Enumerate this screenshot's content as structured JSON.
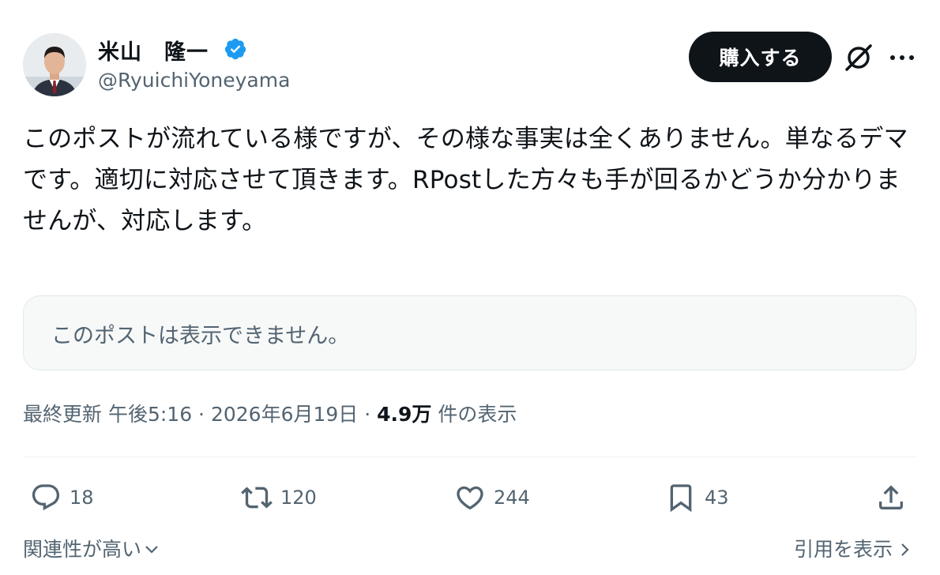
{
  "author": {
    "display_name": "米山　隆一",
    "handle": "@RyuichiYoneyama",
    "verified": true,
    "verified_color": "#1d9bf0"
  },
  "header": {
    "buy_button_label": "購入する",
    "grok_icon": "grok-icon",
    "more_icon": "more-icon"
  },
  "post": {
    "text": "このポストが流れている様ですが、その様な事実は全くありません。単なるデマです。適切に対応させて頂きます。RPostした方々も手が回るかどうか分かりませんが、対応します。"
  },
  "quote": {
    "unavailable_text": "このポストは表示できません。"
  },
  "meta": {
    "prefix": "最終更新",
    "time": "午後5:16",
    "separator": " · ",
    "date": "2026年6月19日",
    "views_count": "4.9万",
    "views_label": "件の表示"
  },
  "actions": {
    "replies": "18",
    "reposts": "120",
    "likes": "244",
    "bookmarks": "43"
  },
  "footer": {
    "sort_label": "関連性が高い",
    "quotes_label": "引用を表示"
  },
  "colors": {
    "text_primary": "#0f1419",
    "text_secondary": "#536471",
    "button_bg": "#0f1419",
    "quote_bg": "#f7f9f9"
  }
}
